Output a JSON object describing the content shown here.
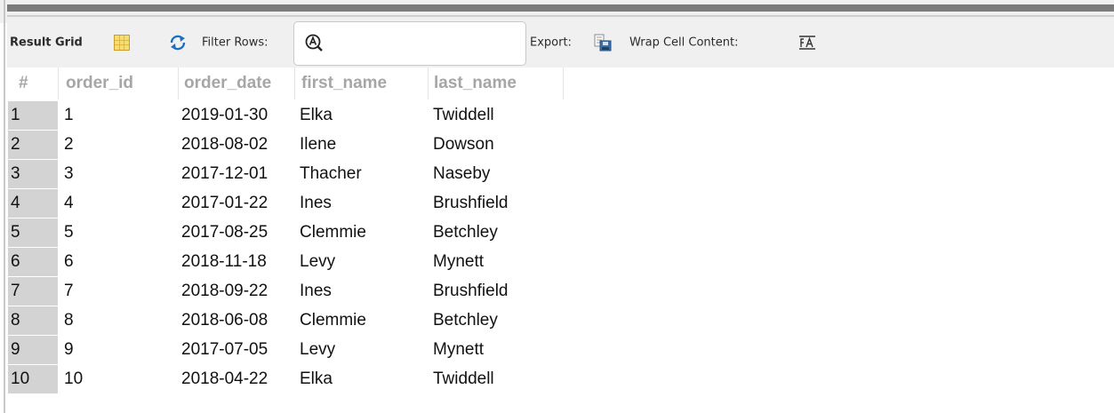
{
  "toolbar": {
    "result_grid_label": "Result Grid",
    "filter_label": "Filter Rows:",
    "filter_value": "",
    "export_label": "Export:",
    "wrap_label": "Wrap Cell Content:"
  },
  "icons": {
    "grid": "grid-icon",
    "refresh": "refresh-icon",
    "search": "search-icon",
    "export": "export-icon",
    "wrap": "wrap-icon"
  },
  "colors": {
    "row_number_bg": "#d3d3d3",
    "header_text": "#a6a6a6",
    "toolbar_bg": "#f0f0f0",
    "refresh_blue": "#1c6fc0",
    "grid_yellow": "#e0b640"
  },
  "grid": {
    "columns": [
      "#",
      "order_id",
      "order_date",
      "first_name",
      "last_name"
    ],
    "rows": [
      [
        "1",
        "1",
        "2019-01-30",
        "Elka",
        "Twiddell"
      ],
      [
        "2",
        "2",
        "2018-08-02",
        "Ilene",
        "Dowson"
      ],
      [
        "3",
        "3",
        "2017-12-01",
        "Thacher",
        "Naseby"
      ],
      [
        "4",
        "4",
        "2017-01-22",
        "Ines",
        "Brushfield"
      ],
      [
        "5",
        "5",
        "2017-08-25",
        "Clemmie",
        "Betchley"
      ],
      [
        "6",
        "6",
        "2018-11-18",
        "Levy",
        "Mynett"
      ],
      [
        "7",
        "7",
        "2018-09-22",
        "Ines",
        "Brushfield"
      ],
      [
        "8",
        "8",
        "2018-06-08",
        "Clemmie",
        "Betchley"
      ],
      [
        "9",
        "9",
        "2017-07-05",
        "Levy",
        "Mynett"
      ],
      [
        "10",
        "10",
        "2018-04-22",
        "Elka",
        "Twiddell"
      ]
    ]
  }
}
